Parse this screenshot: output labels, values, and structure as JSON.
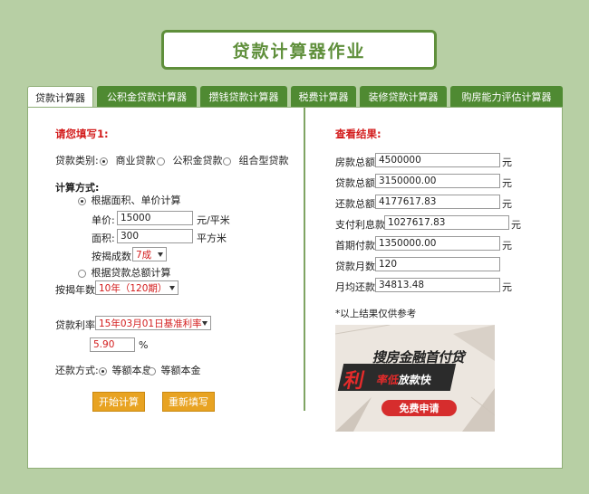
{
  "header": {
    "title": "贷款计算器作业"
  },
  "tabs": [
    {
      "label": "贷款计算器",
      "active": true
    },
    {
      "label": "公积金贷款计算器",
      "active": false
    },
    {
      "label": "攒钱贷款计算器",
      "active": false
    },
    {
      "label": "税费计算器",
      "active": false
    },
    {
      "label": "装修贷款计算器",
      "active": false
    },
    {
      "label": "购房能力评估计算器",
      "active": false
    }
  ],
  "form": {
    "section_title": "请您填写1:",
    "loan_type": {
      "label": "贷款类别:",
      "options": [
        "商业贷款",
        "公积金贷款",
        "组合型贷款"
      ],
      "selected": "商业贷款"
    },
    "calc_method": {
      "label": "计算方式:",
      "option_area": "根据面积、单价计算",
      "option_total": "根据贷款总额计算"
    },
    "unit_price": {
      "label": "单价:",
      "value": "15000",
      "unit": "元/平米"
    },
    "area": {
      "label": "面积:",
      "value": "300",
      "unit": "平方米"
    },
    "mortgage_ratio": {
      "label": "按揭成数",
      "value": "7成"
    },
    "mortgage_years": {
      "label": "按揭年数",
      "value": "10年（120期）"
    },
    "interest_rate": {
      "label": "贷款利率",
      "value": "15年03月01日基准利率",
      "rate_value": "5.90",
      "rate_unit": "%"
    },
    "repayment": {
      "label": "还款方式:",
      "options": [
        "等额本息",
        "等额本金"
      ],
      "selected": "等额本息"
    },
    "buttons": {
      "calculate": "开始计算",
      "reset": "重新填写"
    }
  },
  "results": {
    "section_title": "查看结果:",
    "rows": [
      {
        "label": "房款总额",
        "value": "4500000",
        "unit": "元"
      },
      {
        "label": "贷款总额",
        "value": "3150000.00",
        "unit": "元"
      },
      {
        "label": "还款总额",
        "value": "4177617.83",
        "unit": "元"
      },
      {
        "label": "支付利息款:",
        "value": "1027617.83",
        "unit": "元"
      },
      {
        "label": "首期付款",
        "value": "1350000.00",
        "unit": "元"
      },
      {
        "label": "贷款月数",
        "value": "120",
        "unit": ""
      },
      {
        "label": "月均还款",
        "value": "34813.48",
        "unit": "元"
      }
    ],
    "note": "*以上结果仅供参考"
  },
  "ad": {
    "headline": "搜房金融首付贷",
    "badge": "利",
    "tagline_red": "率低",
    "tagline_white": "放款快",
    "cta": "免费申请"
  },
  "colors": {
    "background": "#b7cfa4",
    "accent_green": "#4f8a32",
    "title_green": "#5f8f3b",
    "red": "#d31c1c",
    "button_orange": "#e8a322"
  }
}
